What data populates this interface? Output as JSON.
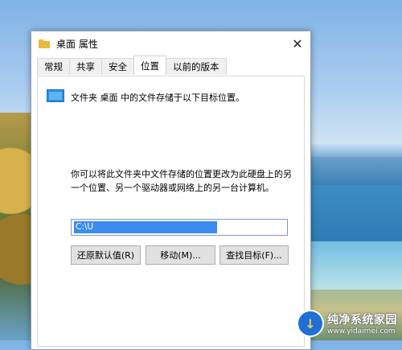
{
  "window": {
    "title": "桌面 属性",
    "close_glyph": "✕"
  },
  "tabs": [
    {
      "label": "常规"
    },
    {
      "label": "共享"
    },
    {
      "label": "安全"
    },
    {
      "label": "位置",
      "active": true
    },
    {
      "label": "以前的版本"
    }
  ],
  "location": {
    "folder_description": "文件夹 桌面 中的文件存储于以下目标位置。",
    "help_text": "你可以将此文件夹中文件存储的位置更改为此硬盘上的另一个位置、另一个驱动器或网络上的另一台计算机。",
    "path_value": "C:\\U",
    "buttons": {
      "restore": "还原默认值(R)",
      "move": "移动(M)...",
      "find_target": "查找目标(F)..."
    }
  },
  "watermark": {
    "name": "纯净系统家园",
    "url": "www.yidaimei.com"
  },
  "colors": {
    "selection": "#3b8bf0",
    "folder_icon": "#2e8fe0",
    "title_folder": "#e8b93c"
  }
}
